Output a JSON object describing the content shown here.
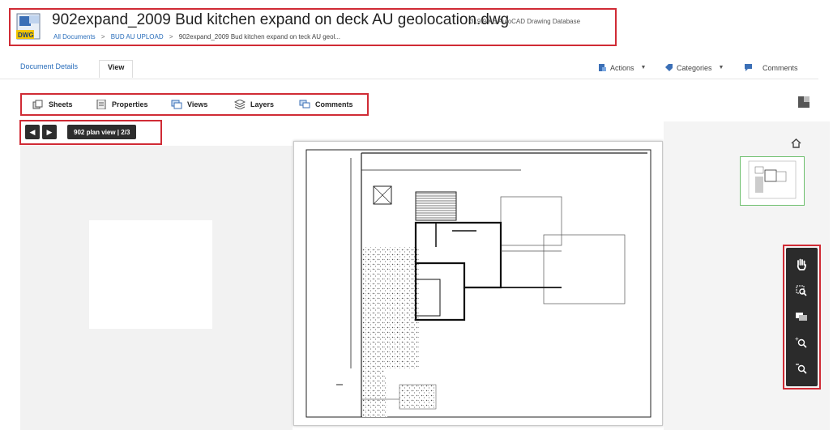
{
  "header": {
    "title": "902expand_2009 Bud kitchen expand on deck AU geolocation.dwg",
    "meta": "319.9 KB AutoCAD Drawing Database",
    "file_badge": "DWG",
    "breadcrumb": {
      "root": "All Documents",
      "separator": ">",
      "folder": "BUD AU UPLOAD",
      "current": "902expand_2009 Bud kitchen expand on teck AU geol..."
    }
  },
  "nav": {
    "tabs": [
      {
        "label": "Document Details"
      },
      {
        "label": "View"
      }
    ],
    "actions_label": "Actions",
    "categories_label": "Categories",
    "comments_label": "Comments"
  },
  "toolbar": {
    "items": [
      {
        "label": "Sheets",
        "icon": "sheets-icon"
      },
      {
        "label": "Properties",
        "icon": "properties-icon"
      },
      {
        "label": "Views",
        "icon": "views-icon"
      },
      {
        "label": "Layers",
        "icon": "layers-icon"
      },
      {
        "label": "Comments",
        "icon": "comments-icon"
      }
    ]
  },
  "pager": {
    "prev_symbol": "◀",
    "next_symbol": "▶",
    "label": "902 plan view  |  2/3"
  },
  "tools": {
    "items": [
      "pan-hand-icon",
      "zoom-window-icon",
      "comment-markup-icon",
      "zoom-in-icon",
      "zoom-out-icon"
    ]
  },
  "colors": {
    "accent_blue": "#2a6ebb",
    "highlight_red": "#d02b35",
    "thumbnail_border": "#6dbf6d",
    "tool_bg": "#2b2b2b"
  }
}
